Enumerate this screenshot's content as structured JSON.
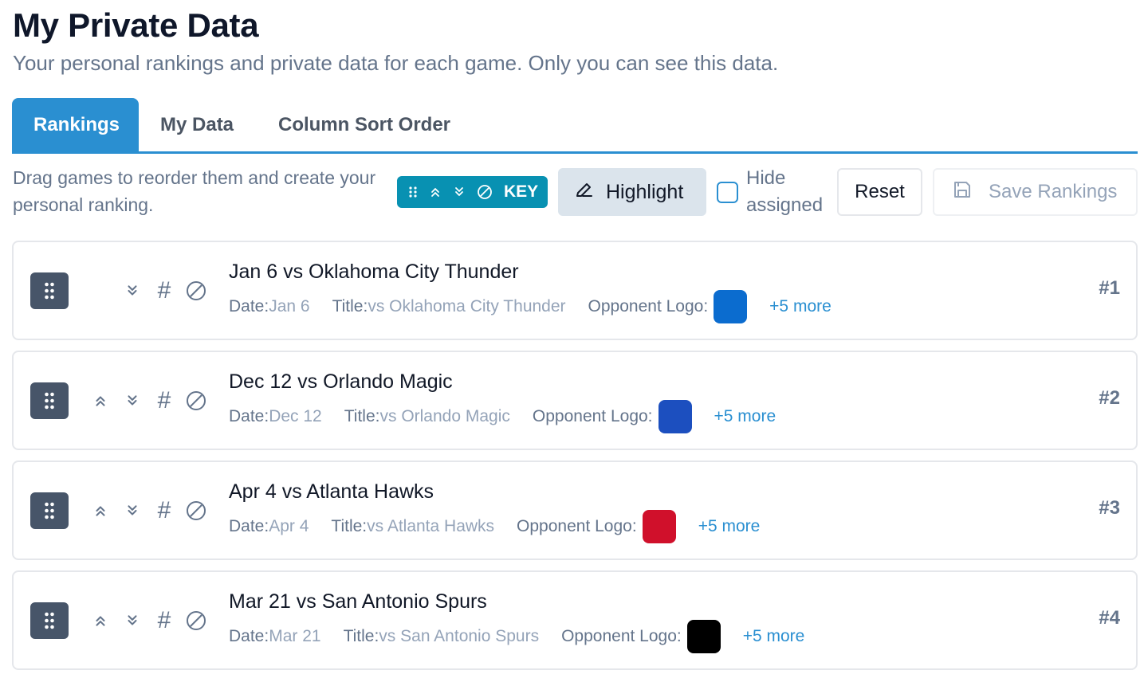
{
  "header": {
    "title": "My Private Data",
    "subtitle": "Your personal rankings and private data for each game. Only you can see this data."
  },
  "tabs": [
    {
      "label": "Rankings",
      "active": true
    },
    {
      "label": "My Data",
      "active": false
    },
    {
      "label": "Column Sort Order",
      "active": false
    }
  ],
  "toolbar": {
    "instructions": "Drag games to reorder them and create your personal ranking.",
    "key_label": "KEY",
    "highlight_label": "Highlight",
    "hide_assigned_label": "Hide assigned",
    "hide_assigned_checked": false,
    "reset_label": "Reset",
    "save_label": "Save Rankings"
  },
  "games": [
    {
      "title": "Jan 6 vs Oklahoma City Thunder",
      "date_key": "Date:",
      "date": "Jan 6",
      "title_key": "Title:",
      "title_value": "vs Oklahoma City Thunder",
      "logo_key": "Opponent Logo:",
      "logo_color": "#0b6ccf",
      "more": "+5 more",
      "rank": "#1",
      "can_move_up": false
    },
    {
      "title": "Dec 12 vs Orlando Magic",
      "date_key": "Date:",
      "date": "Dec 12",
      "title_key": "Title:",
      "title_value": "vs Orlando Magic",
      "logo_key": "Opponent Logo:",
      "logo_color": "#1c4fbf",
      "more": "+5 more",
      "rank": "#2",
      "can_move_up": true
    },
    {
      "title": "Apr 4 vs Atlanta Hawks",
      "date_key": "Date:",
      "date": "Apr 4",
      "title_key": "Title:",
      "title_value": "vs Atlanta Hawks",
      "logo_key": "Opponent Logo:",
      "logo_color": "#d0102b",
      "more": "+5 more",
      "rank": "#3",
      "can_move_up": true
    },
    {
      "title": "Mar 21 vs San Antonio Spurs",
      "date_key": "Date:",
      "date": "Mar 21",
      "title_key": "Title:",
      "title_value": "vs San Antonio Spurs",
      "logo_key": "Opponent Logo:",
      "logo_color": "#000000",
      "more": "+5 more",
      "rank": "#4",
      "can_move_up": true
    }
  ],
  "colors": {
    "accent": "#2a8fd1",
    "key_button": "#0891b2",
    "handle": "#475569"
  }
}
